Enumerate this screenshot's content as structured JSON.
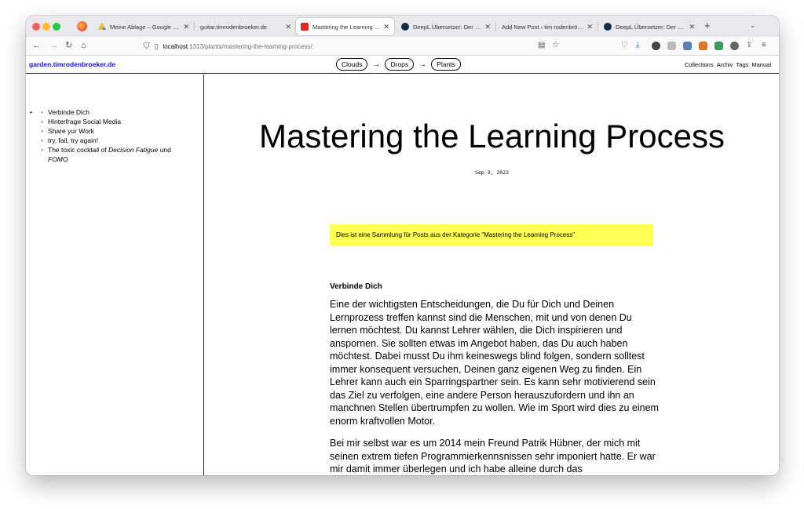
{
  "browser": {
    "tabs": [
      {
        "label": "",
        "icon": "firefox-icon"
      },
      {
        "label": "Meine Ablage – Google Drive",
        "icon": "google-drive-icon"
      },
      {
        "label": "guitar.timrodenbroeker.de",
        "icon": ""
      },
      {
        "label": "Mastering the Learning Proces",
        "icon": "red-square-icon"
      },
      {
        "label": "DeepL Übersetzer: Der präzise",
        "icon": "deepl-icon"
      },
      {
        "label": "Add New Post ‹ tim rodenbröker cre",
        "icon": ""
      },
      {
        "label": "DeepL Übersetzer: Der präzise",
        "icon": "deepl-icon"
      }
    ],
    "new_tab": "+",
    "tab_list": "⌄",
    "close_symbol": "✕",
    "url_host": "localhost",
    "url_rest": ":1313/plants/mastering-the-learning-process/"
  },
  "site": {
    "logo": "garden.timrodenbroeker.de",
    "crumbs": [
      "Clouds",
      "Drops",
      "Plants"
    ],
    "arrow": "→",
    "nav": [
      "Collections",
      "Archiv",
      "Tags",
      "Manual"
    ]
  },
  "toc": {
    "items": [
      {
        "text": "Verbinde Dich"
      },
      {
        "text": "Hinterfrage Social Media"
      },
      {
        "text": "Share yur Work"
      },
      {
        "text": "try, fail, try again!"
      }
    ],
    "last_item": {
      "pre": "The toxic cocktail of ",
      "em1": "Decision Fatigue",
      "mid": " und ",
      "em2": "FOMO"
    }
  },
  "page": {
    "title": "Mastering the Learning Process",
    "date": "Sep 3, 2023",
    "notice": "Dies ist eine Sammlung für Posts aus der Kategorie \"Mastering the Learning Process\"",
    "section_heading": "Verbinde Dich",
    "paragraph1": "Eine der wichtigsten Entscheidungen, die Du für Dich und Deinen Lernprozess treffen kannst sind die Menschen, mit und von denen Du lernen möchtest. Du kannst Lehrer wählen, die Dich inspirieren und anspornen. Sie sollten etwas im Angebot haben, das Du auch haben möchtest. Dabei musst Du ihm keineswegs blind folgen, sondern solltest immer konsequent versuchen, Deinen ganz eigenen Weg zu finden. Ein Lehrer kann auch ein Sparringspartner sein. Es kann sehr motivierend sein das Ziel zu verfolgen, eine andere Person herauszufordern und ihn an manchnen Stellen übertrumpfen zu wollen. Wie im Sport wird dies zu einem enorm kraftvollen Motor.",
    "paragraph2": "Bei mir selbst war es um 2014 mein Freund Patrik Hübner, der mich mit seinen extrem tiefen Programmierkennsnissen sehr imponiert hatte. Er war mir damit immer überlegen und ich habe alleine durch das"
  }
}
